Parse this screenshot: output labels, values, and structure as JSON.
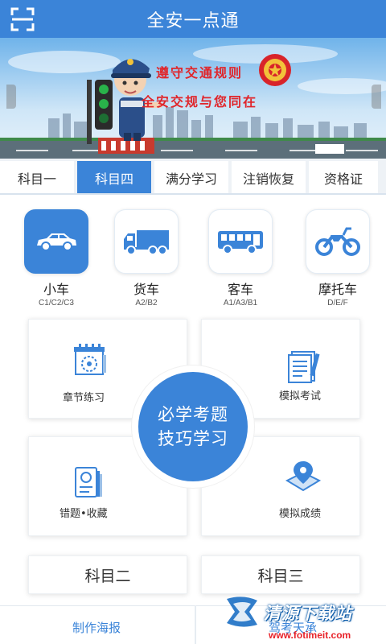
{
  "header": {
    "title": "全安一点通",
    "scan_icon": "scan-icon"
  },
  "banner": {
    "slogan_1": "遵守交通规则",
    "slogan_2": "全安交规与您同在"
  },
  "tabs": [
    {
      "label": "科目一",
      "active": false
    },
    {
      "label": "科目四",
      "active": true
    },
    {
      "label": "满分学习",
      "active": false
    },
    {
      "label": "注销恢复",
      "active": false
    },
    {
      "label": "资格证",
      "active": false
    }
  ],
  "vehicles": [
    {
      "label": "小车",
      "sub": "C1/C2/C3",
      "icon": "car-icon",
      "active": true
    },
    {
      "label": "货车",
      "sub": "A2/B2",
      "icon": "truck-icon",
      "active": false
    },
    {
      "label": "客车",
      "sub": "A1/A3/B1",
      "icon": "bus-icon",
      "active": false
    },
    {
      "label": "摩托车",
      "sub": "D/E/F",
      "icon": "motorcycle-icon",
      "active": false
    }
  ],
  "study": {
    "chapter_practice": "章节练习",
    "mock_exam": "模拟考试",
    "wrong_favorites": "错题•收藏",
    "mock_scores": "模拟成绩",
    "center_line_1": "必学考题",
    "center_line_2": "技巧学习"
  },
  "subjects": {
    "subject_two": "科目二",
    "subject_three": "科目三"
  },
  "bottom": {
    "poster": "制作海报",
    "second": "驾考天承"
  },
  "watermark": {
    "title": "清源下载站",
    "url": "www.fotimeit.com",
    "faded": "站"
  },
  "colors": {
    "primary": "#3b84d8",
    "slogan_red": "#e0262b",
    "background": "#ffffff"
  }
}
